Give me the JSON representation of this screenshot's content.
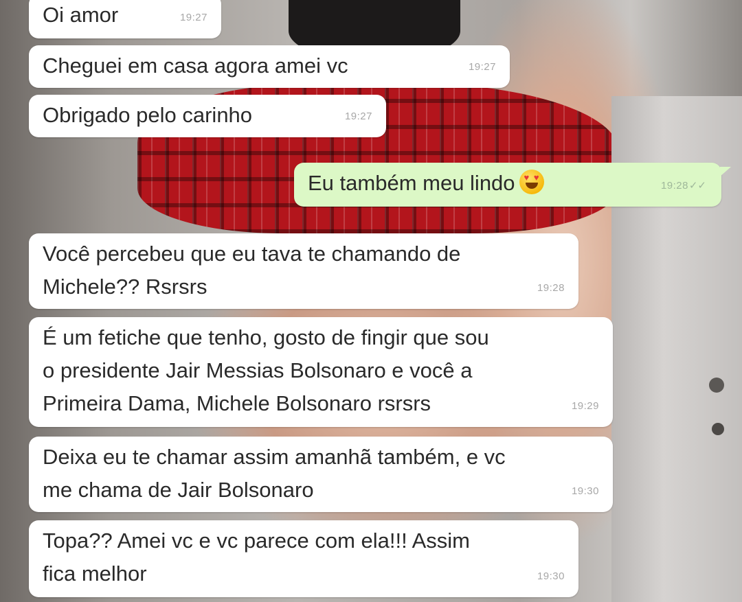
{
  "messages": [
    {
      "dir": "in",
      "text": "Oi amor",
      "time": "19:27"
    },
    {
      "dir": "in",
      "text": "Cheguei em casa agora amei vc",
      "time": "19:27"
    },
    {
      "dir": "in",
      "text": "Obrigado pelo carinho",
      "time": "19:27"
    },
    {
      "dir": "out",
      "text": "Eu também meu lindo",
      "emoji": "smiling-face-with-heart-eyes",
      "time": "19:28",
      "status": "✓✓"
    },
    {
      "dir": "in",
      "text": "Você percebeu que eu tava te chamando de\nMichele?? Rsrsrs",
      "time": "19:28"
    },
    {
      "dir": "in",
      "text": "É um fetiche que tenho, gosto de fingir que sou\no presidente Jair Messias Bolsonaro e você a\nPrimeira Dama, Michele Bolsonaro rsrsrs",
      "time": "19:29"
    },
    {
      "dir": "in",
      "text": "Deixa eu te chamar assim amanhã também, e vc\nme chama de Jair Bolsonaro",
      "time": "19:30"
    },
    {
      "dir": "in",
      "text": "Topa?? Amei vc e vc parece com ela!!! Assim\nfica melhor",
      "time": "19:30"
    }
  ]
}
